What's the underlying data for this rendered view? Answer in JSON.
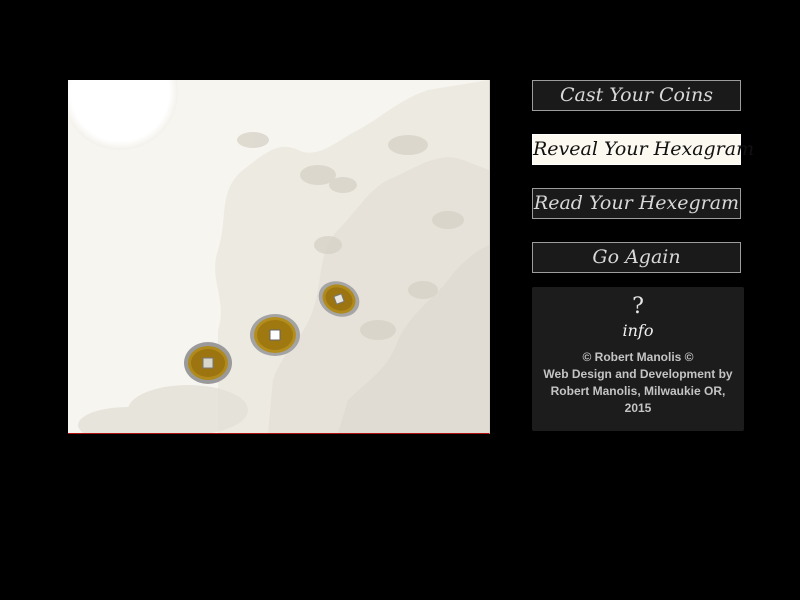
{
  "board": {
    "coins": [
      "coin-1",
      "coin-2",
      "coin-3"
    ]
  },
  "buttons": {
    "cast": "Cast Your Coins",
    "reveal": "Reveal Your Hexagram",
    "read": "Read Your Hexegram",
    "again": "Go Again",
    "active": "reveal"
  },
  "info": {
    "icon": "question-mark-icon",
    "label": "info",
    "credit_line1": "© Robert Manolis ©",
    "credit_line2": "Web Design and Development by Robert Manolis, Milwaukie OR, 2015"
  },
  "colors": {
    "background": "#000000",
    "board": "#f7f5ef",
    "coin_gold": "#b08a1a",
    "coin_rim": "#a9a9a9",
    "button_bg": "#1a1a1a",
    "button_active_bg": "#fbf9f0",
    "panel_bg": "#1c1c1c"
  }
}
